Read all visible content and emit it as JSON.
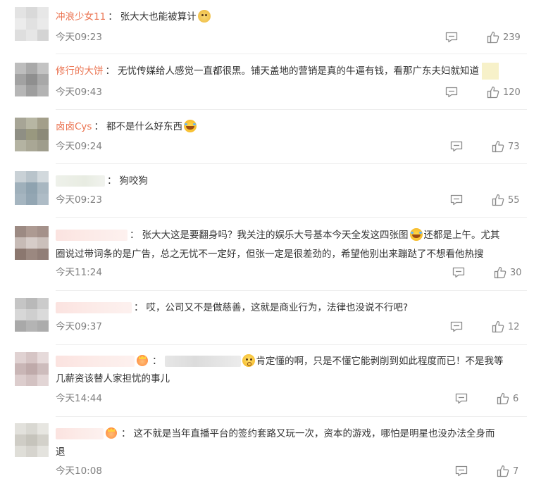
{
  "comments": [
    {
      "name": "冲浪少女11",
      "text": "张大大也能被算计",
      "time": "今天09:23",
      "likes": "239",
      "avatar": [
        "#e3e3e3",
        "#d9d9d9",
        "#e7e7e7",
        "#ececec",
        "#e1e1e1",
        "#eaeaea",
        "#dedede",
        "#e6e6e6",
        "#d4d4d4"
      ]
    },
    {
      "name": "修行的大饼",
      "text": "无忧传媒给人感觉一直都很黑。铺天盖地的营销是真的牛逼有钱，看那广东夫妇就知道",
      "time": "今天09:43",
      "likes": "120",
      "avatar": [
        "#bdbdbd",
        "#a9a9a9",
        "#c3c3c3",
        "#a2a2a2",
        "#8f8f8f",
        "#a8a8a8",
        "#b6b6b6",
        "#9e9e9e",
        "#b3b3b3"
      ]
    },
    {
      "name": "卤卤Cys",
      "text": "都不是什么好东西",
      "time": "今天09:24",
      "likes": "73",
      "avatar": [
        "#a7a596",
        "#b7b6a3",
        "#a39f8a",
        "#8f8f84",
        "#99987f",
        "#8c8a79",
        "#b4b3a2",
        "#a9a795",
        "#9f9d8c"
      ]
    },
    {
      "text": "狗咬狗",
      "time": "今天09:23",
      "likes": "55",
      "avatar": [
        "#c9d1d6",
        "#b9c4cb",
        "#d2d9dd",
        "#9fb0bb",
        "#8fa3b0",
        "#a8b7c1",
        "#a5b5c0",
        "#93a6b3",
        "#aebcc6"
      ]
    },
    {
      "text1": "张大大这是要翻身吗？我关注的娱乐大号基本今天全发这四张图",
      "text2": "还都是上午。尤其",
      "text3": "圈说过带词条的是广告，总之无忧不一定好，但张一定是很差劲的，希望他别出来蹦跶了不想看他热搜",
      "time": "今天11:24",
      "likes": "30",
      "avatar": [
        "#9c8a83",
        "#ad9a92",
        "#a4918a",
        "#c7bbb6",
        "#d6ccc8",
        "#cbc0bb",
        "#8b776f",
        "#9b8880",
        "#917e77"
      ]
    },
    {
      "text": "哎，公司又不是做慈善，这就是商业行为，法律也没说不行吧?",
      "time": "今天09:37",
      "likes": "12",
      "avatar": [
        "#c5c5c5",
        "#b9b9b9",
        "#cbcbcb",
        "#d7d7d7",
        "#cfcfcf",
        "#dadada",
        "#a9a9a9",
        "#b4b4b4",
        "#acacac"
      ]
    },
    {
      "text1": "肯定懂的啊，只是不懂它能剥削到如此程度而已！不是我等",
      "text2": "几薪资该替人家担忧的事儿",
      "time": "今天14:44",
      "likes": "6",
      "avatar": [
        "#e0d2d2",
        "#d6c5c5",
        "#e6dada",
        "#c9b6b6",
        "#bfaaaa",
        "#cdbcbc",
        "#dccdcd",
        "#d3c2c2",
        "#e2d5d5"
      ]
    },
    {
      "text1": "这不就是当年直播平台的签约套路又玩一次，资本的游戏，哪怕是明星也没办法全身而",
      "text2": "退",
      "time": "今天10:08",
      "likes": "7",
      "avatar": [
        "#e2e1dc",
        "#d9d8d2",
        "#e7e6e1",
        "#cfcdc6",
        "#c6c4bc",
        "#d3d1ca",
        "#dfded8",
        "#d6d4ce",
        "#e4e3de"
      ]
    }
  ],
  "colon": "：",
  "icons": {
    "reply": "comment-bubble-icon",
    "like": "thumbs-up-icon",
    "emoji_dog": "dog-face-emoji-icon",
    "emoji_laugh": "laughing-tears-emoji-icon",
    "emoji_think": "thinking-emoji-icon",
    "emoji_crown": "crown-badge-icon"
  },
  "colors": {
    "username": "#eb7350",
    "meta_text": "#808080",
    "divider": "#eeeeee"
  }
}
